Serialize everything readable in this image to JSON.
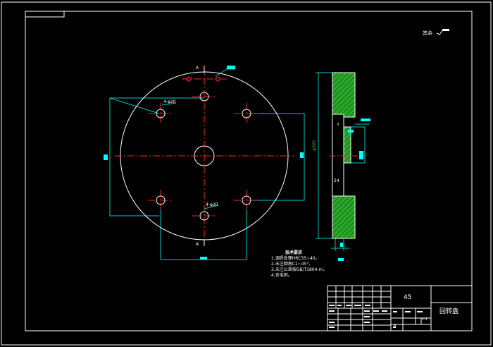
{
  "colors": {
    "background": "#000000",
    "line": "#ffffff",
    "centerline": "#ff2020",
    "dimension": "#00c8c8",
    "section": "#2ecc2e",
    "hidden": "#ffff00",
    "highlight": "#00ffff"
  },
  "drawing": {
    "roughness_note": "其余",
    "sections": [
      "A",
      "A"
    ],
    "hole_callouts": [
      "4-φ20",
      "4-φ20"
    ],
    "side_diameter": "φ320",
    "side_small_dim": "24",
    "tech_req_title": "技术要求",
    "tech_req_lines": [
      "1.调质处理HRC35~40。",
      "2.未注倒角C1~45°。",
      "3.未注公差按GB/T1804-m。",
      "4.去毛刺。"
    ]
  },
  "title_block": {
    "material": "45",
    "part_name": "回转盘",
    "scale": "1:1",
    "sheet": "A"
  }
}
